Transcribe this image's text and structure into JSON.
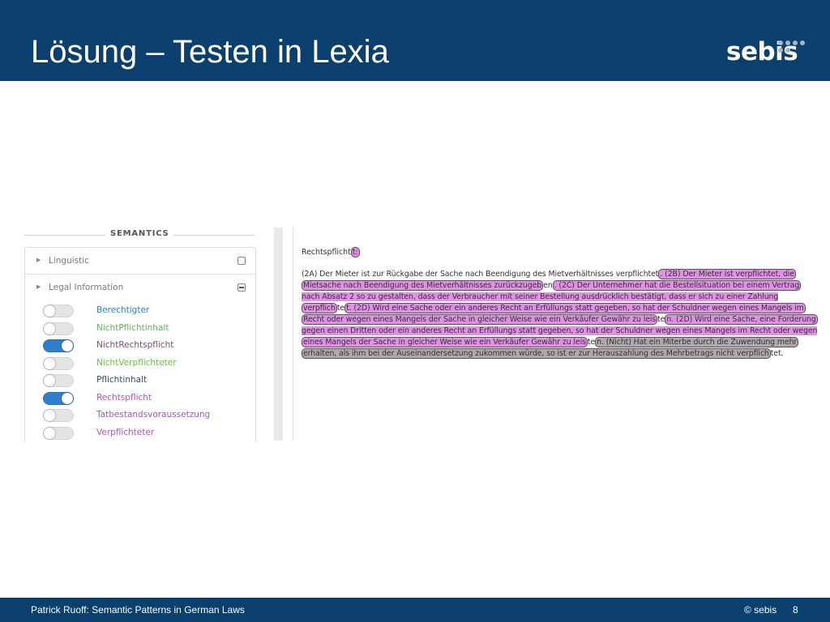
{
  "header": {
    "title": "Lösung – Testen in Lexia",
    "logo_text": "sebis"
  },
  "panel": {
    "title": "SEMANTICS",
    "sections": [
      {
        "label": "Linguistic",
        "state": "collapsed"
      },
      {
        "label": "Legal Information",
        "state": "expanded"
      }
    ],
    "toggles": [
      {
        "label": "Berechtigter",
        "on": false,
        "color": "#2a83c2"
      },
      {
        "label": "NichtPflichtinhalt",
        "on": false,
        "color": "#5cb85c"
      },
      {
        "label": "NichtRechtspflicht",
        "on": true,
        "color": "#7a4f6e"
      },
      {
        "label": "NichtVerpflichteter",
        "on": false,
        "color": "#68c23d"
      },
      {
        "label": "Pflichtinhalt",
        "on": false,
        "color": "#3a4f62"
      },
      {
        "label": "Rechtspflicht",
        "on": true,
        "color": "#c24fc8"
      },
      {
        "label": "Tatbestandsvoraussetzung",
        "on": false,
        "color": "#9b5bb8"
      },
      {
        "label": "Verpflichteter",
        "on": false,
        "color": "#b64fc2"
      }
    ]
  },
  "document": {
    "heading": "Rechtspflicht",
    "heading_tag": "t:",
    "lines": [
      [
        "(2A) Der Mieter ist zur Rückgabe der Sache nach Beendigung des Mietverhältnisses verpflichtet",
        ". (2B) Der Mieter ist verpflichtet, die"
      ],
      [
        "Mietsache nach Beendigung des Mietverhältnisses zurückzugeb",
        "en",
        ". (2C) Der Unternehmer hat die Bestellsituation bei einem Vertrag"
      ],
      [
        "nach Absatz 2 so zu gestalten, dass der Verbraucher mit seiner Bestellung ausdrücklich bestätigt, dass er sich zu einer Zahlung"
      ],
      [
        "verpflich",
        "te",
        "t. (2D) Wird eine Sache oder ein anderes Recht an Erfüllungs statt gegeben, so hat der Schuldner wegen eines Mangels im"
      ],
      [
        "Recht oder wegen eines Mangels der Sache in gleicher Weise wie ein Verkäufer Gewähr zu leis",
        "te",
        "n. (2D) Wird eine Sache, eine Forderung"
      ],
      [
        "gegen einen Dritten oder ein anderes Recht an Erfüllungs statt gegeben, so hat der Schuldner wegen eines Mangels im Recht oder wegen"
      ],
      [
        "eines Mangels der Sache in gleicher Weise wie ein Verkäufer Gewähr zu leis",
        "te",
        "n. (Nicht) Hat ein Miterbe durch die Zuwendung mehr"
      ],
      [
        "erhalten, als ihm bei der Auseinandersetzung zukommen würde, so ist er zur Herauszahlung des Mehrbetrags nicht verpflich",
        "tet."
      ]
    ]
  },
  "footer": {
    "left": "Patrick Ruoff: Semantic Patterns in German Laws",
    "copyright": "© sebis",
    "page": "8"
  }
}
